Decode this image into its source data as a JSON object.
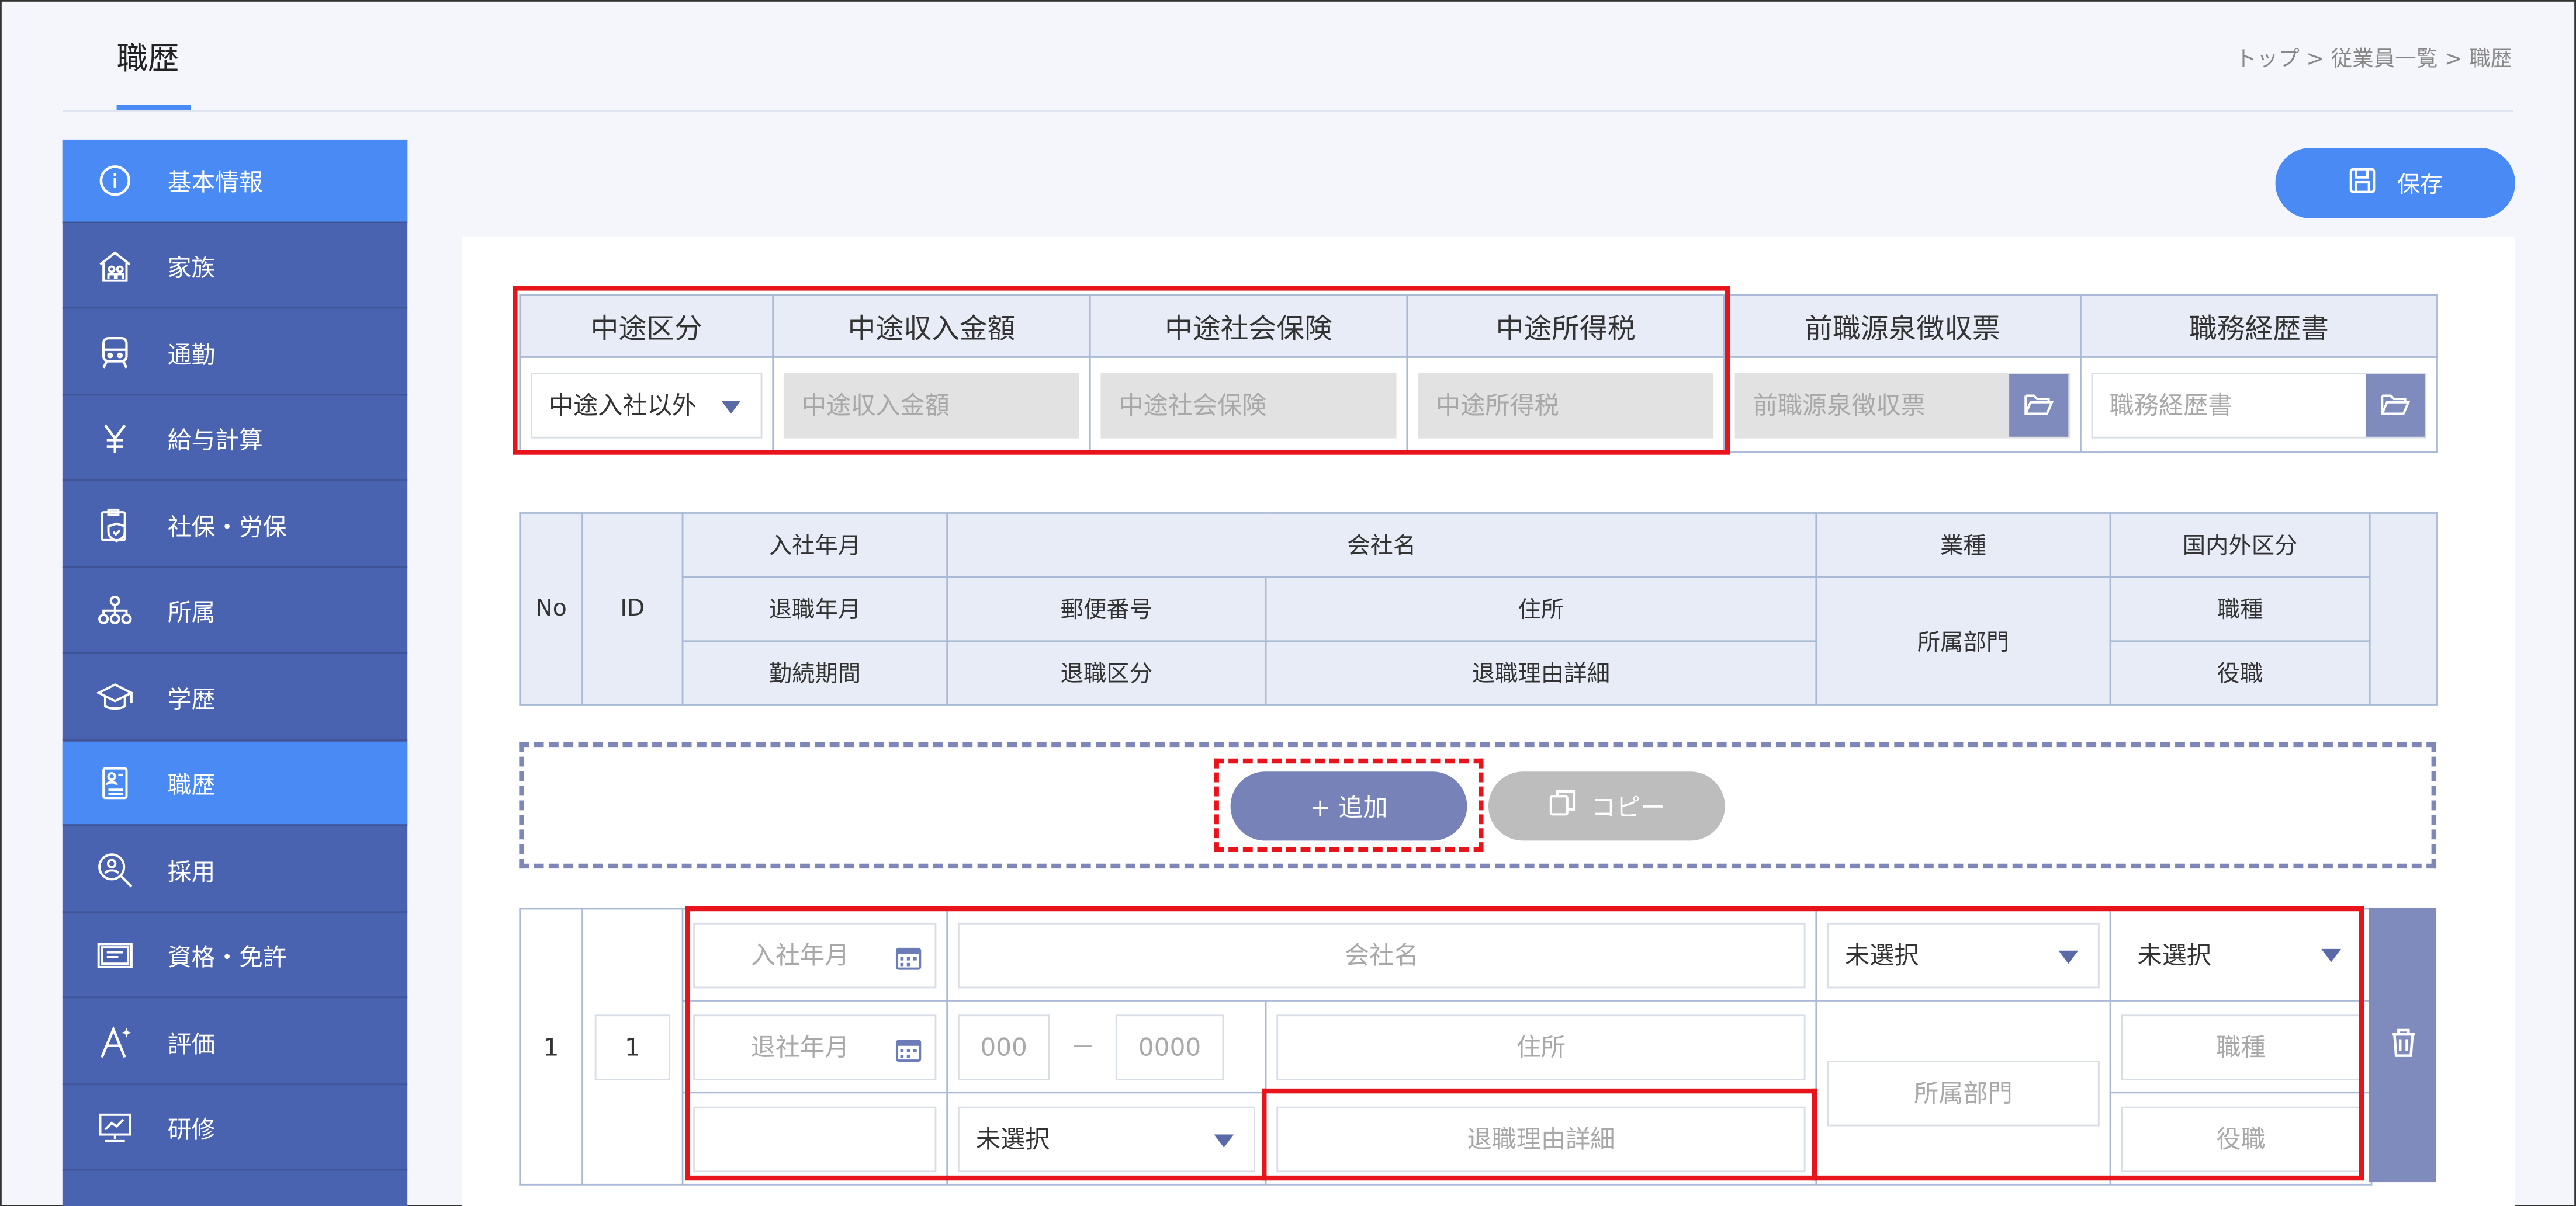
{
  "page": {
    "title": "職歴"
  },
  "breadcrumb": {
    "text": "トップ > 従業員一覧 > 職歴"
  },
  "sidebar": {
    "items": [
      {
        "label": "基本情報",
        "icon": "info-icon",
        "active": true
      },
      {
        "label": "家族",
        "icon": "house-family-icon",
        "active": false
      },
      {
        "label": "通勤",
        "icon": "train-icon",
        "active": false
      },
      {
        "label": "給与計算",
        "icon": "yen-icon",
        "active": false
      },
      {
        "label": "社保・労保",
        "icon": "clipboard-shield-icon",
        "active": false
      },
      {
        "label": "所属",
        "icon": "org-chart-icon",
        "active": false
      },
      {
        "label": "学歴",
        "icon": "graduation-cap-icon",
        "active": false
      },
      {
        "label": "職歴",
        "icon": "resume-icon",
        "active": true
      },
      {
        "label": "採用",
        "icon": "magnifier-person-icon",
        "active": false
      },
      {
        "label": "資格・免許",
        "icon": "certificate-icon",
        "active": false
      },
      {
        "label": "評価",
        "icon": "star-a-icon",
        "active": false
      },
      {
        "label": "研修",
        "icon": "presentation-icon",
        "active": false
      }
    ]
  },
  "toolbar": {
    "save_label": "保存"
  },
  "midcareer": {
    "headers": [
      "中途区分",
      "中途収入金額",
      "中途社会保険",
      "中途所得税",
      "前職源泉徴収票",
      "職務経歴書"
    ],
    "kubun_value": "中途入社以外",
    "placeholders": [
      "中途収入金額",
      "中途社会保険",
      "中途所得税",
      "前職源泉徴収票",
      "職務経歴書"
    ]
  },
  "history_header": {
    "no": "No",
    "id": "ID",
    "r1": [
      "入社年月",
      "会社名",
      "業種",
      "国内外区分"
    ],
    "r2": [
      "退職年月",
      "郵便番号",
      "住所",
      "所属部門",
      "職種"
    ],
    "r3": [
      "勤続期間",
      "退職区分",
      "退職理由詳細",
      "役職"
    ]
  },
  "actions": {
    "add_label": "+  追加",
    "copy_label": "コピー"
  },
  "row": {
    "no": "1",
    "id": "1",
    "join_ph": "入社年月",
    "company_ph": "会社名",
    "industry": "未選択",
    "domestic": "未選択",
    "leave_ph": "退社年月",
    "zip1_ph": "000",
    "zip_sep": "－",
    "zip2_ph": "0000",
    "address_ph": "住所",
    "dept_ph": "所属部門",
    "job_ph": "職種",
    "leave_type": "未選択",
    "reason_ph": "退職理由詳細",
    "position_ph": "役職"
  }
}
